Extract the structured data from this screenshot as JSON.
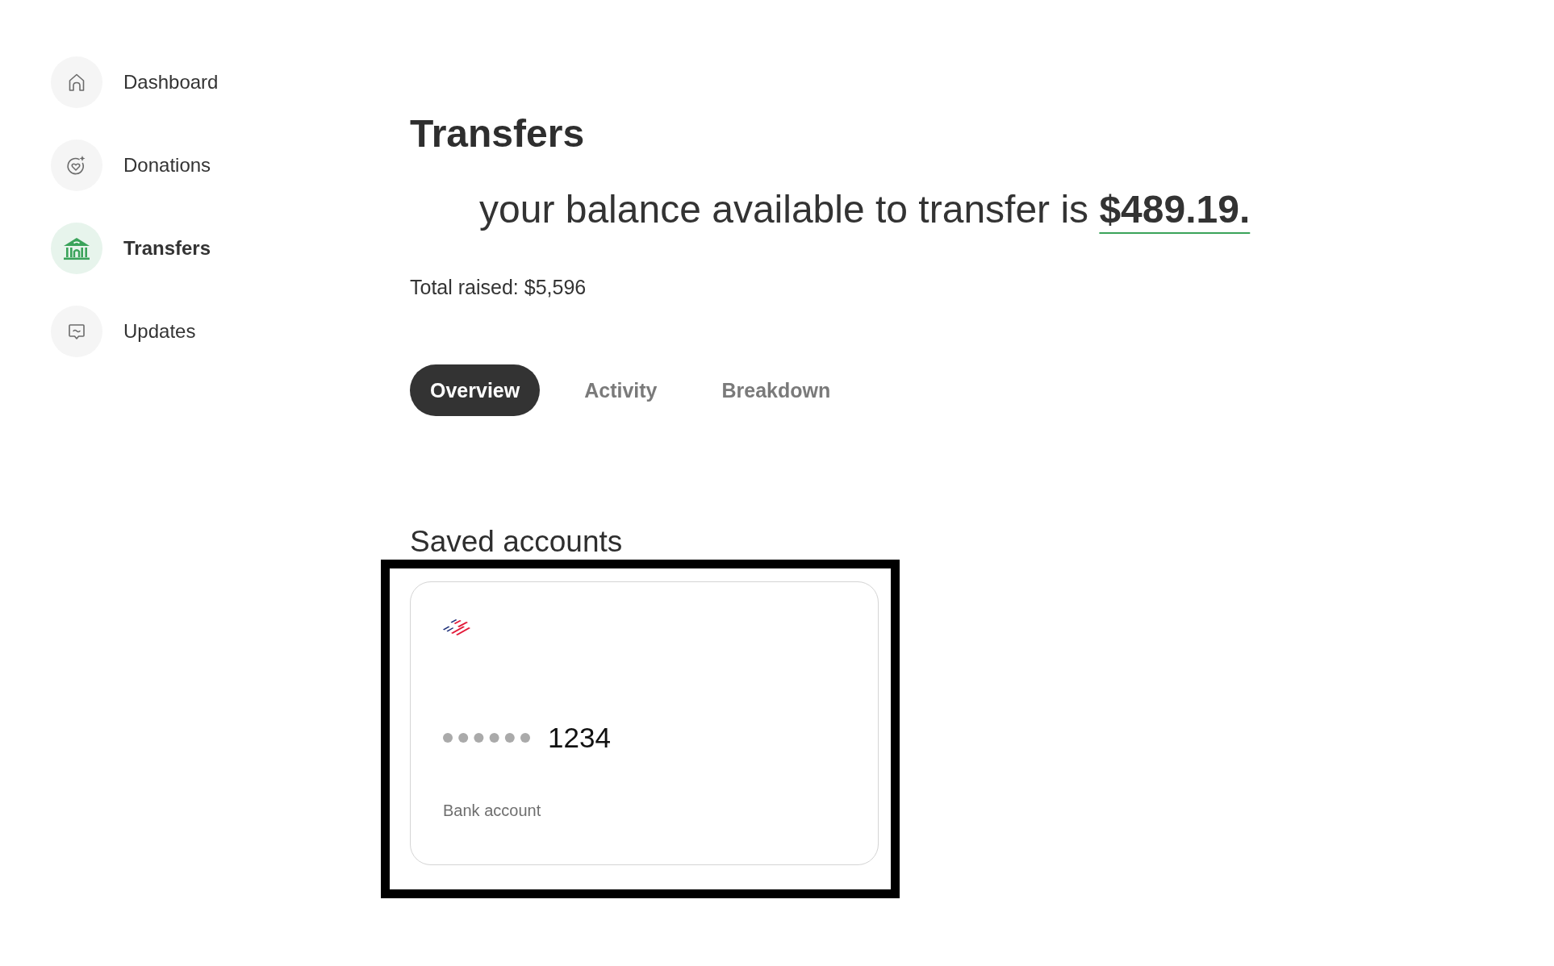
{
  "sidebar": {
    "items": [
      {
        "label": "Dashboard",
        "selected": false
      },
      {
        "label": "Donations",
        "selected": false
      },
      {
        "label": "Transfers",
        "selected": true
      },
      {
        "label": "Updates",
        "selected": false
      }
    ]
  },
  "header": {
    "title": "Transfers",
    "balance": "your balance available to transfer is **$489.19.**",
    "total_raised": "Total raised: $5,596"
  },
  "tabs": [
    {
      "label": "Overview",
      "selected": true
    },
    {
      "label": "Activity",
      "selected": false
    },
    {
      "label": "Breakdown",
      "selected": false
    }
  ],
  "saved_accounts": {
    "heading": "Saved accounts",
    "highlighted": true,
    "accounts": [
      {
        "last_digits": "1234",
        "type": "Bank account"
      }
    ]
  }
}
